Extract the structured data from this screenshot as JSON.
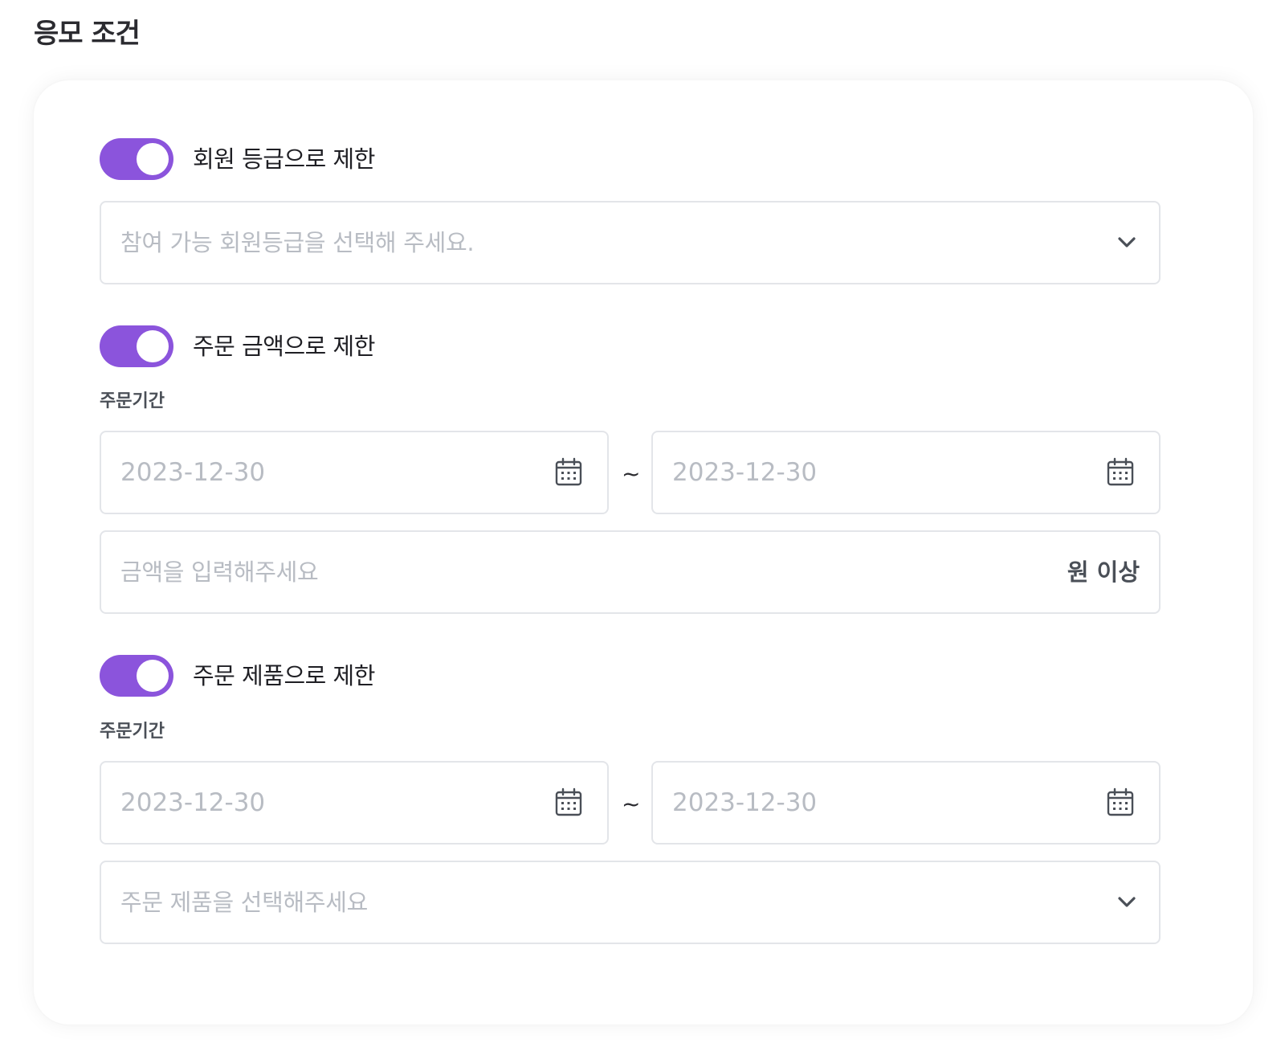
{
  "section_title": "응모 조건",
  "member_grade": {
    "toggle_label": "회원 등급으로 제한",
    "enabled": true,
    "select_placeholder": "참여 가능 회원등급을 선택해 주세요."
  },
  "order_amount": {
    "toggle_label": "주문 금액으로 제한",
    "enabled": true,
    "period_label": "주문기간",
    "start_date_placeholder": "2023-12-30",
    "end_date_placeholder": "2023-12-30",
    "range_separator": "~",
    "amount_placeholder": "금액을 입력해주세요",
    "amount_unit": "원 이상"
  },
  "order_product": {
    "toggle_label": "주문 제품으로 제한",
    "enabled": true,
    "period_label": "주문기간",
    "start_date_placeholder": "2023-12-30",
    "end_date_placeholder": "2023-12-30",
    "range_separator": "~",
    "product_placeholder": "주문 제품을 선택해주세요"
  },
  "icons": {
    "dropdown": "chevron-down-icon",
    "date": "calendar-icon"
  },
  "colors": {
    "toggle_on": "#8b54dc",
    "border": "#e3e5e9",
    "placeholder": "#b8bcc3"
  }
}
